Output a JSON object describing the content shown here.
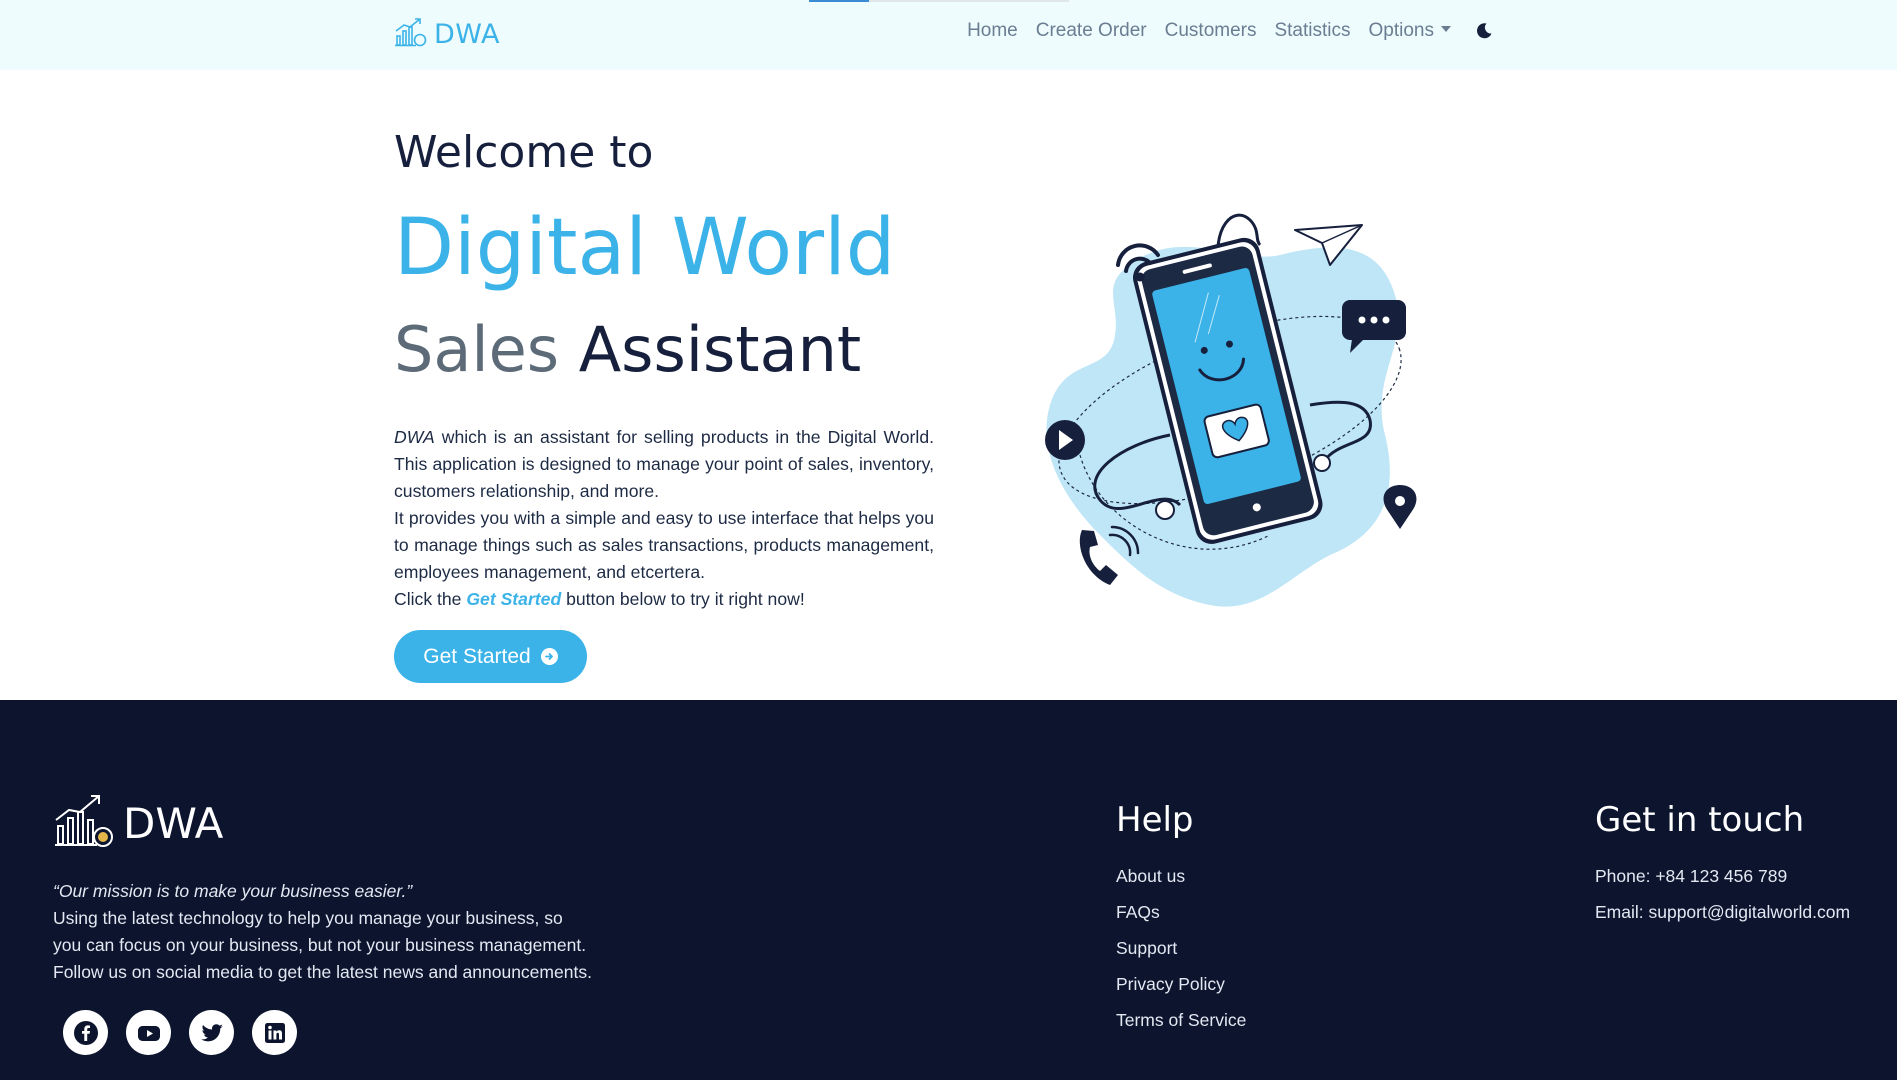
{
  "navbar": {
    "brand": "DWA",
    "links": [
      "Home",
      "Create Order",
      "Customers",
      "Statistics"
    ],
    "options_label": "Options",
    "theme_icon": "moon-icon"
  },
  "hero": {
    "welcome": "Welcome to",
    "title": "Digital World",
    "subtitle_light": "Sales",
    "subtitle_dark": "Assistant",
    "desc_brand": "DWA",
    "desc_p1": "which is an assistant for selling products in the Digital World. This application is designed to manage your point of sales, inventory, customers relationship, and more.",
    "desc_p2": "It provides you with a simple and easy to use interface that helps you to manage things such as sales transactions, products management, employees management, and etcertera.",
    "desc_p3_before": "Click the",
    "desc_p3_link": "Get Started",
    "desc_p3_after": "button below to try it right now!",
    "cta_label": "Get Started",
    "colors": {
      "accent": "#3bb3e8",
      "dark": "#16203d"
    }
  },
  "footer": {
    "brand": "DWA",
    "mission": "“Our mission is to make your business easier.”",
    "about_lines": [
      "Using the latest technology to help you manage your business, so",
      "you can focus on your business, but not your business management.",
      "Follow us on social media to get the latest news and announcements."
    ],
    "socials": [
      "facebook-icon",
      "youtube-icon",
      "twitter-icon",
      "linkedin-icon"
    ],
    "help_heading": "Help",
    "help_links": [
      "About us",
      "FAQs",
      "Support",
      "Privacy Policy",
      "Terms of Service"
    ],
    "contact_heading": "Get in touch",
    "phone": "Phone: +84 123 456 789",
    "email": "Email: support@digitalworld.com",
    "background": "#0c142e"
  }
}
